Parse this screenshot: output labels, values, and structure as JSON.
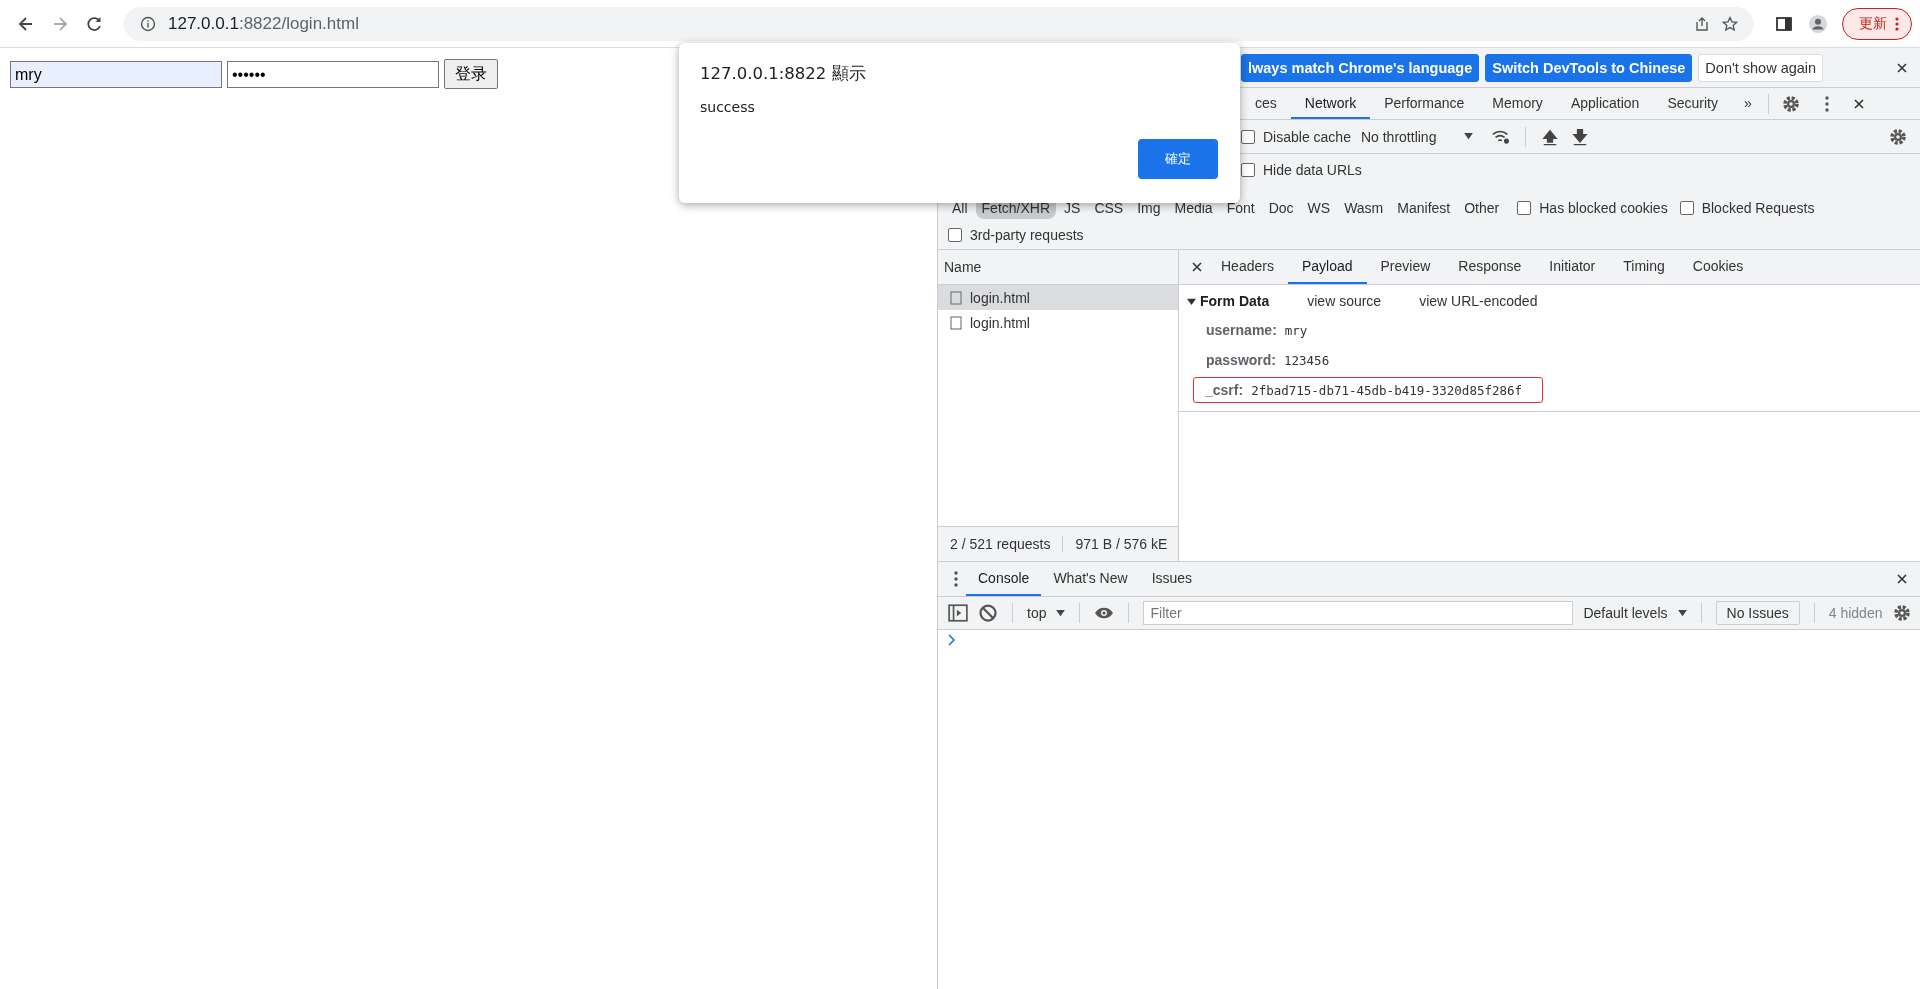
{
  "browser": {
    "url_host": "127.0.0.1",
    "url_path": ":8822/login.html",
    "update_label": "更新"
  },
  "page": {
    "username": "mry",
    "password": "••••••",
    "submit": "登录"
  },
  "dialog": {
    "title": "127.0.0.1:8822 顯示",
    "message": "success",
    "ok": "確定"
  },
  "infobar": {
    "buttons": [
      {
        "label": "lways match Chrome's language",
        "primary": true
      },
      {
        "label": "Switch DevTools to Chinese",
        "primary": true
      },
      {
        "label": "Don't show again",
        "primary": false
      }
    ]
  },
  "devtools_tabs": [
    {
      "label": "ces",
      "selected": false
    },
    {
      "label": "Network",
      "selected": true
    },
    {
      "label": "Performance",
      "selected": false
    },
    {
      "label": "Memory",
      "selected": false
    },
    {
      "label": "Application",
      "selected": false
    },
    {
      "label": "Security",
      "selected": false
    }
  ],
  "more_tabs": "»",
  "network_toolbar": {
    "disable_cache": {
      "label": "Disable cache",
      "checked": false
    },
    "throttling": "No throttling"
  },
  "hide_data_urls": {
    "label": "Hide data URLs",
    "checked": false
  },
  "type_filters": [
    {
      "label": "All",
      "selected": false
    },
    {
      "label": "Fetch/XHR",
      "selected": true
    },
    {
      "label": "JS",
      "selected": false
    },
    {
      "label": "CSS",
      "selected": false
    },
    {
      "label": "Img",
      "selected": false
    },
    {
      "label": "Media",
      "selected": false
    },
    {
      "label": "Font",
      "selected": false
    },
    {
      "label": "Doc",
      "selected": false
    },
    {
      "label": "WS",
      "selected": false
    },
    {
      "label": "Wasm",
      "selected": false
    },
    {
      "label": "Manifest",
      "selected": false
    },
    {
      "label": "Other",
      "selected": false
    }
  ],
  "filter_checks": [
    {
      "label": "Has blocked cookies",
      "checked": false
    },
    {
      "label": "Blocked Requests",
      "checked": false
    }
  ],
  "third_party": {
    "label": "3rd-party requests",
    "checked": false
  },
  "requests": {
    "column": "Name",
    "rows": [
      {
        "name": "login.html",
        "selected": true
      },
      {
        "name": "login.html",
        "selected": false
      }
    ],
    "summary": [
      "2 / 521 requests",
      "971 B / 576 kE"
    ]
  },
  "detail_tabs": [
    {
      "label": "Headers",
      "selected": false
    },
    {
      "label": "Payload",
      "selected": true
    },
    {
      "label": "Preview",
      "selected": false
    },
    {
      "label": "Response",
      "selected": false
    },
    {
      "label": "Initiator",
      "selected": false
    },
    {
      "label": "Timing",
      "selected": false
    },
    {
      "label": "Cookies",
      "selected": false
    }
  ],
  "form_data": {
    "title": "Form Data",
    "expanded": true,
    "links": [
      "view source",
      "view URL-encoded"
    ],
    "fields": [
      {
        "key": "username:",
        "value": "mry",
        "outlined": false
      },
      {
        "key": "password:",
        "value": "123456",
        "outlined": false
      },
      {
        "key": "_csrf:",
        "value": "2fbad715-db71-45db-b419-3320d85f286f",
        "outlined": true
      }
    ]
  },
  "drawer_tabs": [
    {
      "label": "Console",
      "selected": true
    },
    {
      "label": "What's New",
      "selected": false
    },
    {
      "label": "Issues",
      "selected": false
    }
  ],
  "console_toolbar": {
    "context": "top",
    "filter_placeholder": "Filter",
    "levels": "Default levels",
    "issues": "No Issues",
    "hidden": "4 hidden"
  }
}
